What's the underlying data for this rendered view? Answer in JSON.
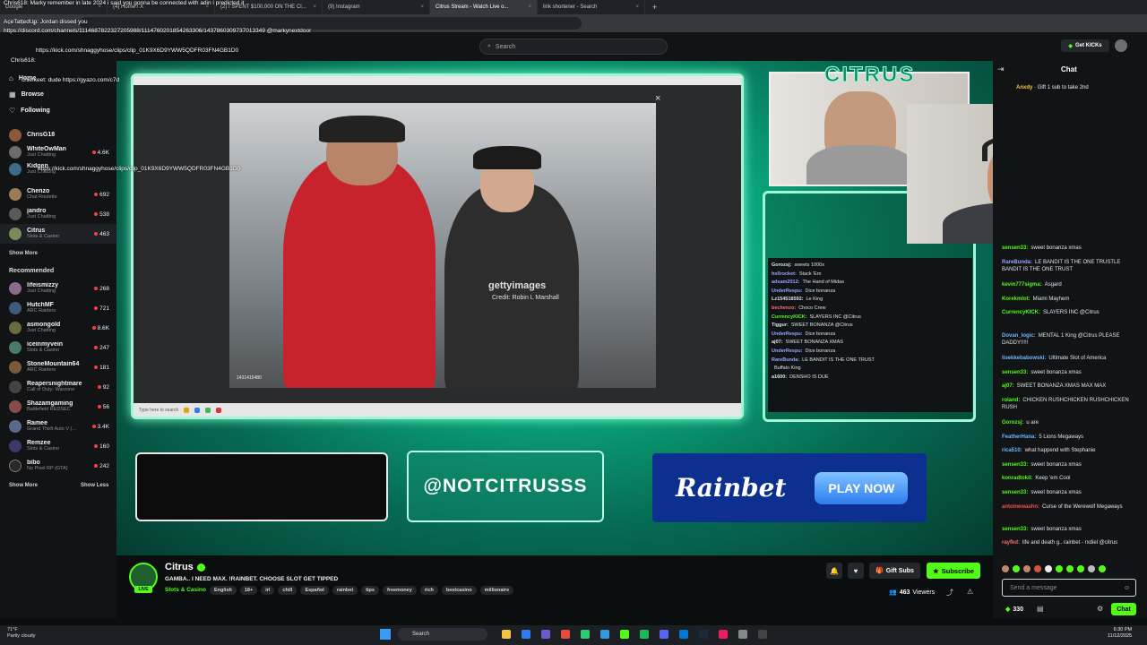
{
  "browser": {
    "tabs": [
      {
        "label": "Google",
        "active": false
      },
      {
        "label": "(4) Home / X",
        "active": false
      },
      {
        "label": "(2) I SPENT $100,000 ON THE CI...",
        "active": false
      },
      {
        "label": "(9) Instagram",
        "active": false
      },
      {
        "label": "Citrus Stream - Watch Live o...",
        "active": true
      },
      {
        "label": "link shortener - Search",
        "active": false
      }
    ],
    "new_tab": "+"
  },
  "overlay_text": {
    "line1": "Chris618: Marky remember in late 2024 i said you gonna be connected with adin i predicted it",
    "line2": "AceTattedUp: Jordan dissed you",
    "line3": "https://discord.com/channels/1114687822327205988/1114760201854263306/1437860309737013349 @markynextdoor",
    "line4": "https://kick.com/shnaggyhose/clips/clip_01K9X6D9YWW5QDFR03FN4GB1D0",
    "line5": "Chris618:",
    "line6": "chiefkeet: dude https://gyazo.com/c7d",
    "line7": "https://kick.com/shnaggyhose/clips/clip_01K9X6D9YWW5QDFR03FN4GB1D0"
  },
  "header": {
    "search_placeholder": "Search",
    "get_kicks": "Get KICKs"
  },
  "sidebar": {
    "nav": [
      "Home",
      "Browse",
      "Following"
    ],
    "following": [
      {
        "name": "ChrisG18",
        "cat": "",
        "count": ""
      },
      {
        "name": "WhiteOwMan",
        "cat": "Just Chatting",
        "count": "4.6K"
      },
      {
        "name": "Kidgen",
        "cat": "Just Chatting",
        "count": ""
      },
      {
        "name": "Chenzo",
        "cat": "Chat Roulette",
        "count": "692"
      },
      {
        "name": "jandro",
        "cat": "Just Chatting",
        "count": "538"
      },
      {
        "name": "Citrus",
        "cat": "Slots & Casino",
        "count": "463"
      }
    ],
    "show_more_1": "Show More",
    "recommended_title": "Recommended",
    "recommended": [
      {
        "name": "lifeismizzy",
        "cat": "Just Chatting",
        "count": "268"
      },
      {
        "name": "HutchMF",
        "cat": "ARC Raiders",
        "count": "721"
      },
      {
        "name": "asmongold",
        "cat": "Just Chatting",
        "count": "8.6K"
      },
      {
        "name": "iceinmyvein",
        "cat": "Slots & Casino",
        "count": "247"
      },
      {
        "name": "StoneMountain64",
        "cat": "ARC Raiders",
        "count": "181"
      },
      {
        "name": "Reapersnightmare",
        "cat": "Call of Duty: Warzone",
        "count": "92"
      },
      {
        "name": "Shazamgaming",
        "cat": "Battlefield REDSEC",
        "count": "56"
      },
      {
        "name": "Ramee",
        "cat": "Grand Theft Auto V (...",
        "count": "3.4K"
      },
      {
        "name": "Remzee",
        "cat": "Slots & Casino",
        "count": "160"
      },
      {
        "name": "bibo",
        "cat": "No Pixel RP (GTA)",
        "count": "242"
      }
    ],
    "show_more_2": "Show More",
    "show_less": "Show Less"
  },
  "stream": {
    "photo_watermark": "gettyimages",
    "photo_credit": "Credit: Robin L Marshall",
    "photo_id": "1431415480",
    "inner_search": "Type here to search",
    "cam_logo": "CITRUS",
    "overlay_chat": [
      {
        "user": "Gorozsj:",
        "msg": "sweets 1000x",
        "color": "#e0e0e0"
      },
      {
        "user": "hellrocket:",
        "msg": "Stack 'Em",
        "color": "#9aa4ff"
      },
      {
        "user": "adsam2012:",
        "msg": "The Hand of Midas",
        "color": "#9aa4ff"
      },
      {
        "user": "UnderRespu:",
        "msg": "Dice bonanza",
        "color": "#9aa4ff"
      },
      {
        "user": "Lz154518592:",
        "msg": "Le King",
        "color": "#e0e0e0"
      },
      {
        "user": "bechenzo:",
        "msg": "Choco Crew",
        "color": "#ff6b6b"
      },
      {
        "user": "CurrencyKICK:",
        "msg": "SLAYERS INC @Citrus",
        "color": "#53fc18"
      },
      {
        "user": "Tiggur:",
        "msg": "SWEET BONANZA @Citrus",
        "color": "#e0e0e0"
      },
      {
        "user": "UnderRespu:",
        "msg": "Dice bonanza",
        "color": "#9aa4ff"
      },
      {
        "user": "aj07:",
        "msg": "SWEET BONANZA XMAS",
        "color": "#e0e0e0"
      },
      {
        "user": "UnderRespu:",
        "msg": "Dice bonanza",
        "color": "#9aa4ff"
      },
      {
        "user": "RareBunda:",
        "msg": "LE BANDIT IS THE ONE TRUST",
        "color": "#9aa4ff"
      },
      {
        "user": "",
        "msg": "Buffalo King",
        "color": "#ff4d4d"
      },
      {
        "user": "a1600:",
        "msg": "DENSHO IS DUE",
        "color": "#e0e0e0"
      }
    ],
    "handle": "@NOTCITRUSSS",
    "rainbet": "Rainbet",
    "play_now": "PLAY NOW"
  },
  "channel": {
    "name": "Citrus",
    "live": "LIVE",
    "title": "GAMBA.. I NEED MAX. !RAINBET. CHOOSE SLOT GET TIPPED",
    "category": "Slots & Casino",
    "tags": [
      "English",
      "18+",
      "irl",
      "chill",
      "Español",
      "rainbet",
      "tips",
      "freemoney",
      "rich",
      "bestcasino",
      "millionaire"
    ],
    "gift_subs": "Gift Subs",
    "subscribe": "Subscribe",
    "viewers": "463",
    "viewers_label": "Viewers"
  },
  "chat": {
    "title": "Chat",
    "pinned_user": "Anxdy",
    "pinned": "Gift 1 sub to take 2nd",
    "messages": [
      {
        "user": "sensen33:",
        "msg": "sweet bonanza xmas",
        "color": "#53fc18"
      },
      {
        "user": "RareBunda:",
        "msg": "LE BANDIT IS THE ONE TRUSTLE BANDIT IS THE ONE TRUST",
        "color": "#9aa4ff"
      },
      {
        "user": "kevin777sigma:",
        "msg": "Asgard",
        "color": "#53fc18"
      },
      {
        "user": "Korekmlot:",
        "msg": "Miami Mayhem",
        "color": "#53fc18"
      },
      {
        "user": "CurrencyKICK:",
        "msg": "SLAYERS INC @Citrus",
        "color": "#53fc18"
      },
      {
        "user": "Dovan_logic:",
        "msg": "MENTAL 1 King @Citrus PLEASE DADDY!!!!!",
        "color": "#6fb7ff"
      },
      {
        "user": "lisekkebabowski:",
        "msg": "Ultimate Slot of America",
        "color": "#6fb7ff"
      },
      {
        "user": "sensen33:",
        "msg": "sweet bonanza xmas",
        "color": "#53fc18"
      },
      {
        "user": "aj07:",
        "msg": "SWEET BONANZA XMAS MAX MAX",
        "color": "#53fc18"
      },
      {
        "user": "roland:",
        "msg": "CHICKEN RUSHCHICKEN RUSHCHICKEN RUSH",
        "color": "#53fc18"
      },
      {
        "user": "Gorozsj:",
        "msg": "u are",
        "color": "#53fc18"
      },
      {
        "user": "FeatherHana:",
        "msg": "5 Lions Megaways",
        "color": "#6fb7ff"
      },
      {
        "user": "rica510:",
        "msg": "what happend with Stephanie",
        "color": "#6fb7ff"
      },
      {
        "user": "sensen33:",
        "msg": "sweet bonanza xmas",
        "color": "#53fc18"
      },
      {
        "user": "konradtokil:",
        "msg": "Keep 'em Cool",
        "color": "#53fc18"
      },
      {
        "user": "sensen33:",
        "msg": "sweet bonanza xmas",
        "color": "#53fc18"
      },
      {
        "user": "antoinewashn:",
        "msg": "Curse of the Werewolf Megaways",
        "color": "#ff4d4d"
      },
      {
        "user": "sensen33:",
        "msg": "sweet bonanza xmas",
        "color": "#53fc18"
      },
      {
        "user": "rayfkd:",
        "msg": "life and death g.. rainbet - rxdiel @citrus",
        "color": "#ff6b6b"
      }
    ],
    "input_placeholder": "Send a message",
    "points": "330",
    "chat_button": "Chat"
  },
  "taskbar": {
    "weather_temp": "71°F",
    "weather_desc": "Partly cloudy",
    "search": "Search",
    "time": "6:30 PM",
    "date": "11/12/2025"
  }
}
